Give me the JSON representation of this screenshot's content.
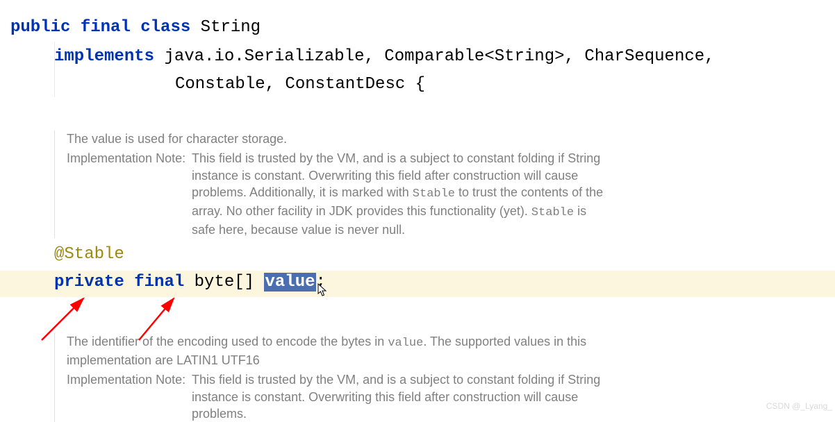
{
  "code": {
    "l1_public": "public",
    "l1_final": "final",
    "l1_class": "class",
    "l1_type": "String",
    "l2_implements": "implements",
    "l2_types_a": "java.io.Serializable, Comparable<String>, CharSequence,",
    "l3_types_b": "Constable, ConstantDesc {",
    "annotation": "@Stable",
    "f_private": "private",
    "f_final": "final",
    "f_type": "byte[]",
    "f_name": "value",
    "f_semi": ";"
  },
  "doc1": {
    "p1": "The value is used for character storage.",
    "label": "Implementation Note:",
    "body_a": "This field is trusted by the VM, and is a subject to constant folding if String instance is constant. Overwriting this field after construction will cause problems. Additionally, it is marked with ",
    "stable1": "Stable",
    "body_b": " to trust the contents of the array. No other facility in JDK provides this functionality (yet). ",
    "stable2": "Stable",
    "body_c": " is safe here, because value is never null."
  },
  "doc2": {
    "p1_a": "The identifier of the encoding used to encode the bytes in ",
    "p1_code": "value",
    "p1_b": ". The supported values in this implementation are LATIN1 UTF16",
    "label": "Implementation Note:",
    "body": "This field is trusted by the VM, and is a subject to constant folding if String instance is constant. Overwriting this field after construction will cause problems."
  },
  "watermark": "CSDN @_Lyang_"
}
